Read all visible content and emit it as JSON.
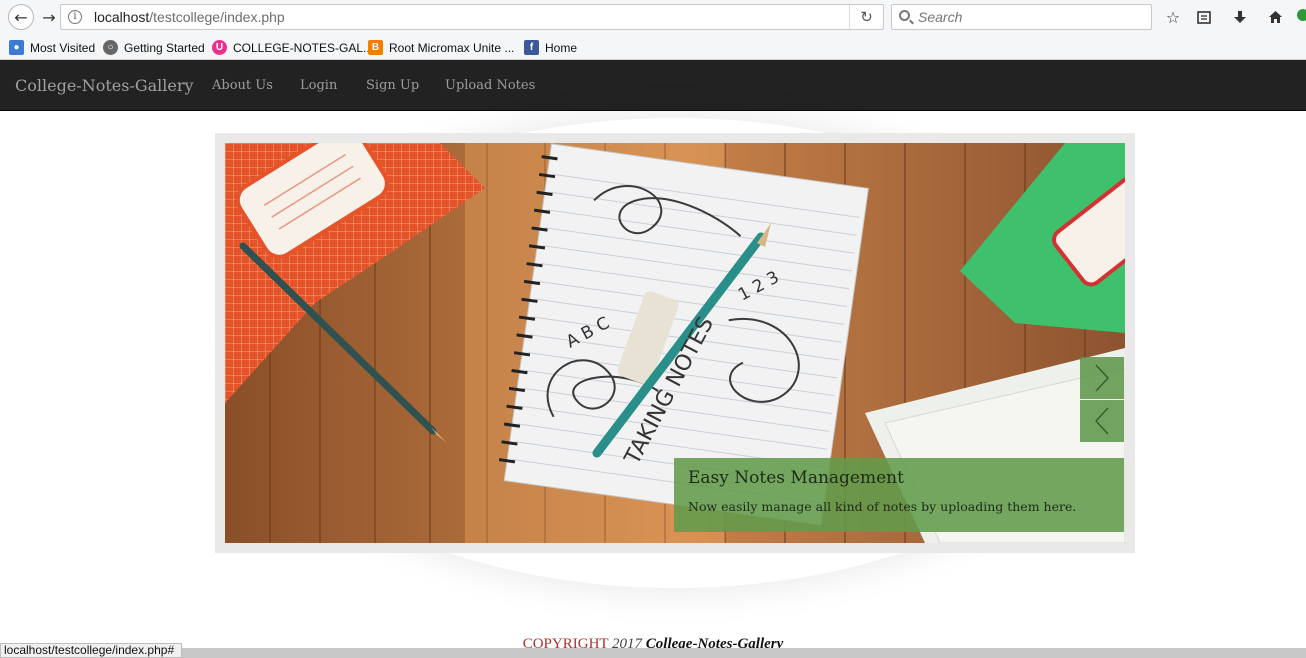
{
  "browser": {
    "url_host": "localhost",
    "url_path": "/testcollege/index.php",
    "search_placeholder": "Search",
    "bookmarks": [
      {
        "label": "Most Visited",
        "icon": "most-visited-icon",
        "color": "#3a7bd5"
      },
      {
        "label": "Getting Started",
        "icon": "globe-icon",
        "color": "#666666"
      },
      {
        "label": "COLLEGE-NOTES-GAL...",
        "icon": "app-icon",
        "color": "#e8308c"
      },
      {
        "label": "Root Micromax Unite ...",
        "icon": "blogger-icon",
        "color": "#f57d00"
      },
      {
        "label": "Home",
        "icon": "facebook-icon",
        "color": "#3b5998"
      }
    ],
    "status_url": "localhost/testcollege/index.php#"
  },
  "navbar": {
    "brand": "College-Notes-Gallery",
    "links": [
      "About Us",
      "Login",
      "Sign Up",
      "Upload Notes"
    ]
  },
  "slider": {
    "caption_title": "Easy Notes Management",
    "caption_text": "Now easily manage all kind of notes by uploading them here.",
    "notebook_text": "TAKING NOTES",
    "letters": "A B C",
    "numbers": "1 2 3",
    "accent_color": "#5c9448"
  },
  "footer": {
    "copyright": "COPYRIGHT",
    "year": "2017",
    "name": "College-Notes-Gallery"
  }
}
